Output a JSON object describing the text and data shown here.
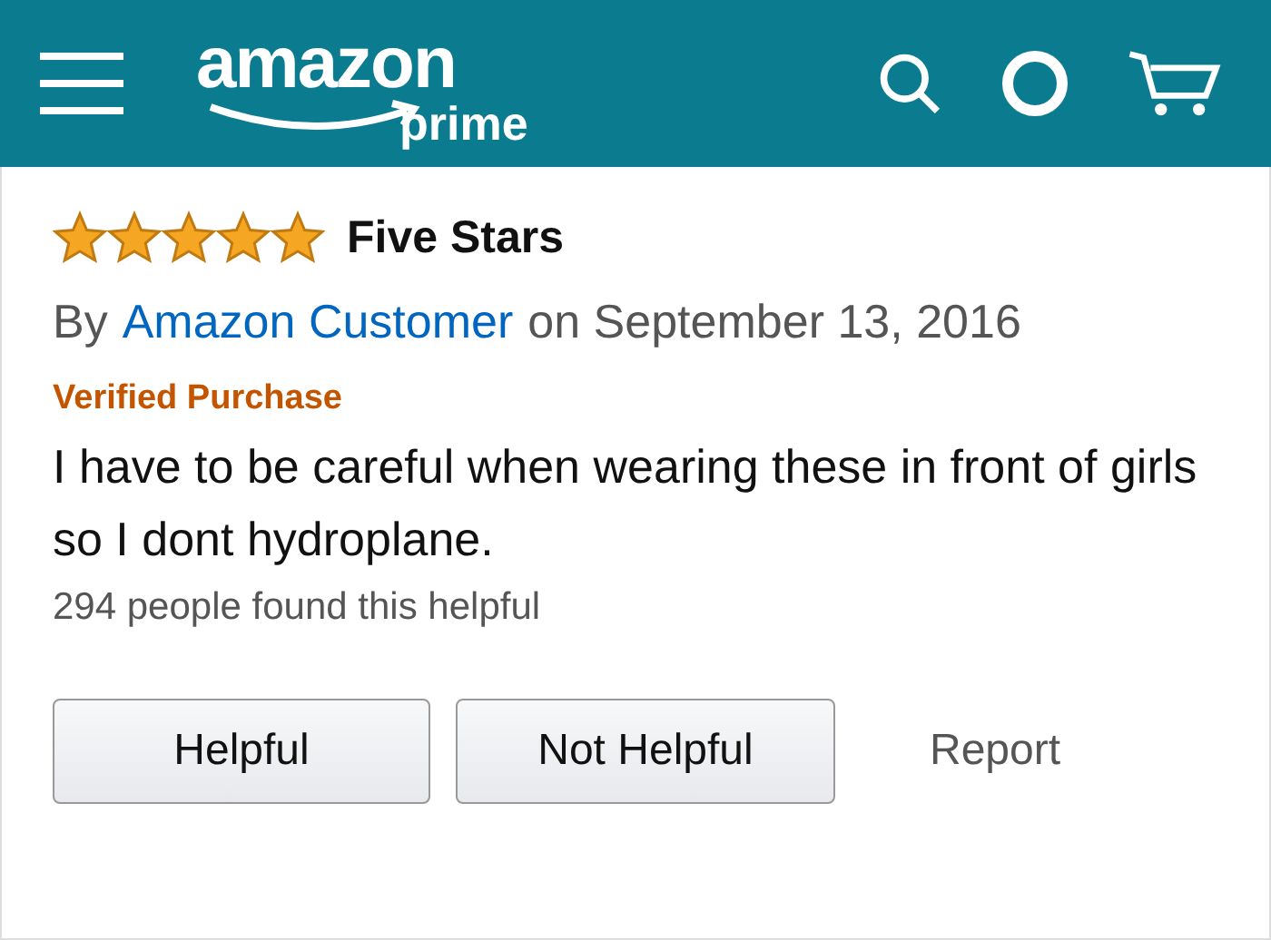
{
  "header": {
    "logo_text": "amazon",
    "logo_subtext": "prime"
  },
  "review": {
    "stars": 5,
    "title": "Five Stars",
    "by": "By",
    "author": "Amazon Customer",
    "date": "on September 13, 2016",
    "badge": "Verified Purchase",
    "body": "I have to be careful when wearing these in front of girls so I dont hydroplane.",
    "helpful_count": "294 people found this helpful"
  },
  "actions": [
    {
      "label": "Helpful",
      "kind": "button"
    },
    {
      "label": "Not Helpful",
      "kind": "button"
    },
    {
      "label": "Report",
      "kind": "link"
    }
  ]
}
